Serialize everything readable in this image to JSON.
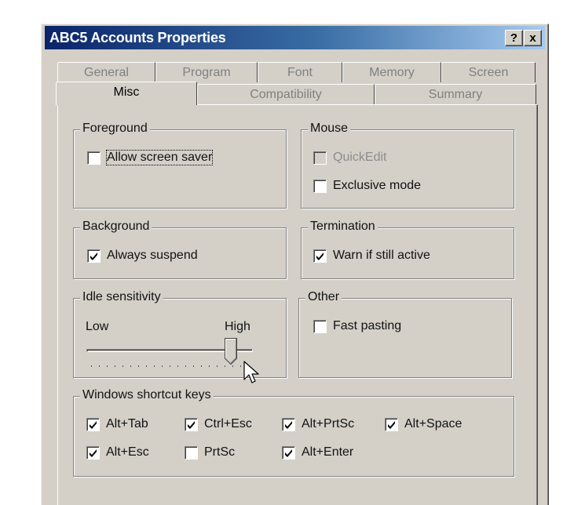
{
  "window": {
    "title": "ABC5 Accounts Properties",
    "help_label": "?",
    "close_label": "x"
  },
  "tabs": {
    "row1": [
      "General",
      "Program",
      "Font",
      "Memory",
      "Screen"
    ],
    "row2": [
      "Misc",
      "Compatibility",
      "Summary"
    ],
    "active": "Misc"
  },
  "groups": {
    "foreground": {
      "title": "Foreground",
      "allow_screen_saver": {
        "label": "Allow screen saver",
        "checked": false
      }
    },
    "mouse": {
      "title": "Mouse",
      "quickedit": {
        "label": "QuickEdit",
        "checked": false,
        "enabled": false
      },
      "exclusive_mode": {
        "label": "Exclusive mode",
        "checked": false
      }
    },
    "background": {
      "title": "Background",
      "always_suspend": {
        "label": "Always suspend",
        "checked": true
      }
    },
    "termination": {
      "title": "Termination",
      "warn_if_active": {
        "label": "Warn if still active",
        "checked": true
      }
    },
    "idle": {
      "title": "Idle sensitivity",
      "low_label": "Low",
      "high_label": "High",
      "level": 0.85
    },
    "other": {
      "title": "Other",
      "fast_pasting": {
        "label": "Fast pasting",
        "checked": false
      }
    },
    "shortcuts": {
      "title": "Windows shortcut keys",
      "alt_tab": {
        "label": "Alt+Tab",
        "checked": true
      },
      "ctrl_esc": {
        "label": "Ctrl+Esc",
        "checked": true
      },
      "alt_prtsc": {
        "label": "Alt+PrtSc",
        "checked": true
      },
      "alt_space": {
        "label": "Alt+Space",
        "checked": true
      },
      "alt_esc": {
        "label": "Alt+Esc",
        "checked": true
      },
      "prtsc": {
        "label": "PrtSc",
        "checked": false
      },
      "alt_enter": {
        "label": "Alt+Enter",
        "checked": true
      }
    }
  },
  "colors": {
    "titlebar_start": "#0a246a",
    "titlebar_end": "#a6caf0",
    "face": "#d4d0c8",
    "desktop": "#ffffff"
  }
}
